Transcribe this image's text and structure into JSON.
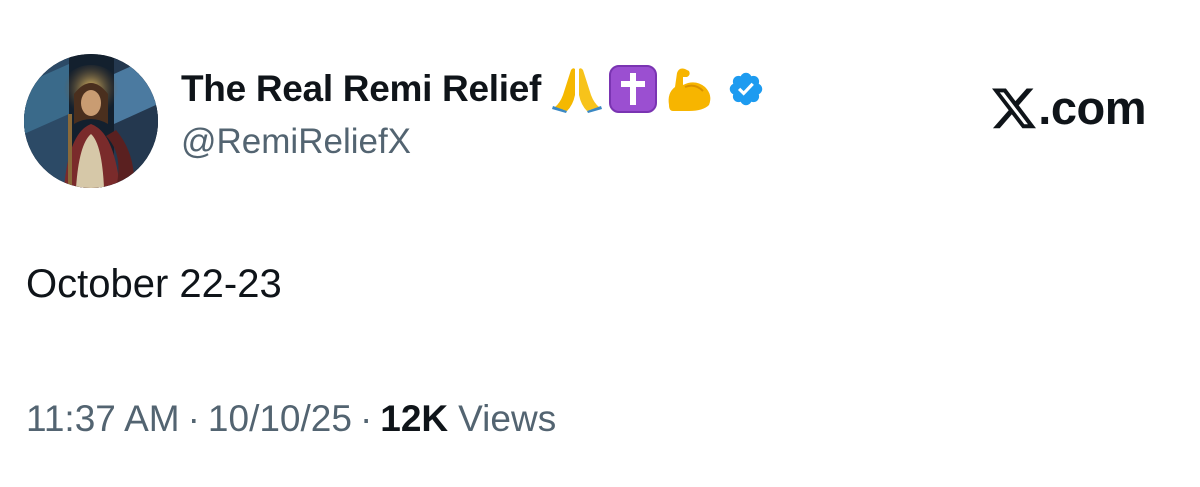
{
  "tweet": {
    "author": {
      "display_name": "The Real Remi Relief",
      "handle": "@RemiReliefX",
      "name_emojis": [
        "folded-hands",
        "latin-cross",
        "flexed-biceps"
      ],
      "verified": true,
      "verified_color": "#1d9bf0"
    },
    "site_logo": {
      "domain_text": ".com",
      "icon": "x-logo-icon"
    },
    "text": "October 22-23",
    "meta": {
      "time": "11:37 AM",
      "separator": "·",
      "date": "10/10/25",
      "views_count": "12K",
      "views_label": "Views"
    }
  }
}
